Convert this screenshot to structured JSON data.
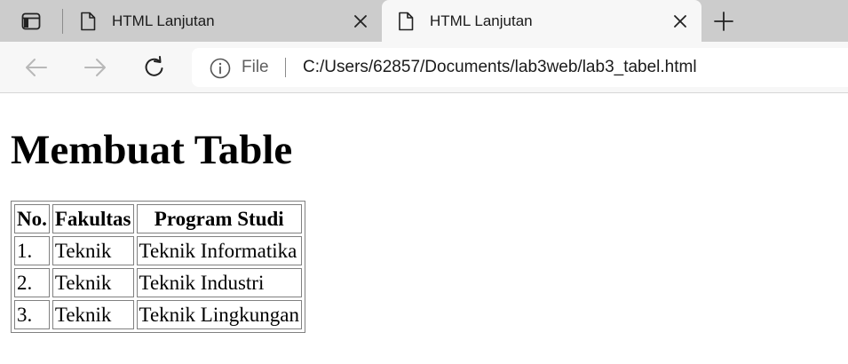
{
  "browser": {
    "tabs": [
      {
        "title": "HTML Lanjutan",
        "active": false
      },
      {
        "title": "HTML Lanjutan",
        "active": true
      }
    ],
    "address": {
      "scheme_label": "File",
      "url": "C:/Users/62857/Documents/lab3web/lab3_tabel.html"
    },
    "icons": {
      "tab_actions": "tab-actions-icon",
      "page": "page-icon",
      "close": "close-icon",
      "new_tab": "plus-icon",
      "back": "back-arrow-icon",
      "forward": "forward-arrow-icon",
      "reload": "reload-icon",
      "info": "info-icon"
    }
  },
  "page": {
    "heading": "Membuat Table",
    "table": {
      "headers": [
        "No.",
        "Fakultas",
        "Program Studi"
      ],
      "rows": [
        [
          "1.",
          "Teknik",
          "Teknik Informatika"
        ],
        [
          "2.",
          "Teknik",
          "Teknik Industri"
        ],
        [
          "3.",
          "Teknik",
          "Teknik Lingkungan"
        ]
      ]
    }
  },
  "colors": {
    "tabstrip": "#cccccc",
    "toolbar": "#f7f7f7",
    "omnibox": "#ffffff",
    "table_border": "#808080"
  }
}
